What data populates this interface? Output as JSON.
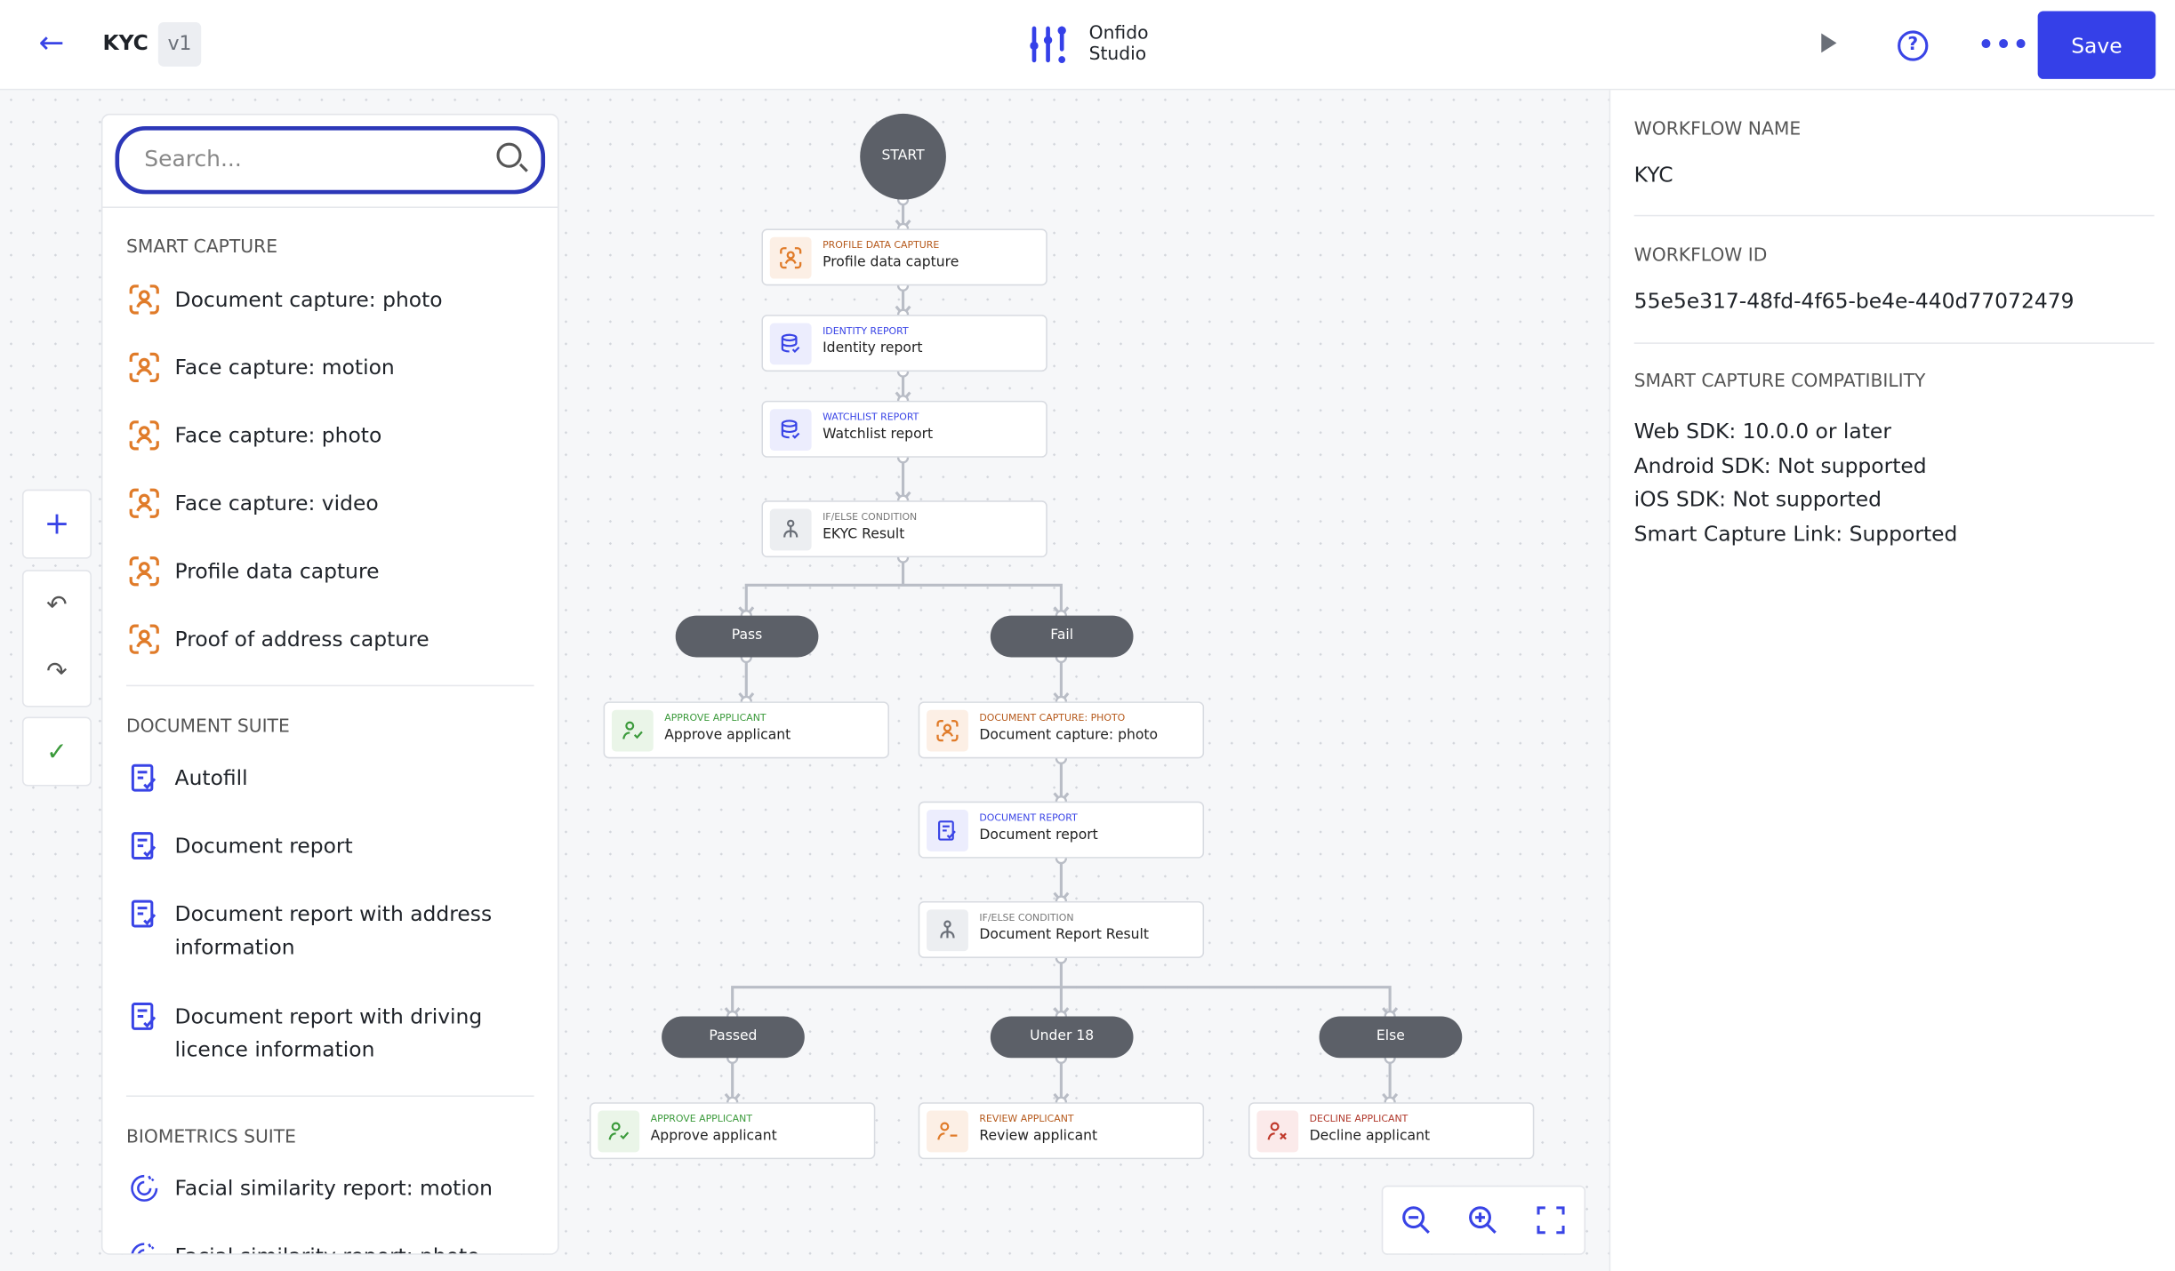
{
  "header": {
    "title": "KYC",
    "version": "v1",
    "brand_line1": "Onfido",
    "brand_line2": "Studio",
    "save_label": "Save",
    "help": "?",
    "more": "•••"
  },
  "colors": {
    "accent": "#3540e8",
    "capture": "#e07b29",
    "report": "#3944e6",
    "approve": "#3b9a3b",
    "decline": "#c0392b",
    "neutral": "#5c6068"
  },
  "search": {
    "placeholder": "Search...",
    "value": ""
  },
  "sidebar": {
    "sections": [
      {
        "title": "SMART CAPTURE",
        "items": [
          "Document capture: photo",
          "Face capture: motion",
          "Face capture: photo",
          "Face capture: video",
          "Profile data capture",
          "Proof of address capture"
        ]
      },
      {
        "title": "DOCUMENT SUITE",
        "items": [
          "Autofill",
          "Document report",
          "Document report with address information",
          "Document report with driving licence information"
        ]
      },
      {
        "title": "BIOMETRICS SUITE",
        "items": [
          "Facial similarity report: motion",
          "Facial similarity report: photo"
        ]
      }
    ]
  },
  "right_panel": {
    "workflow_name_label": "WORKFLOW NAME",
    "workflow_name": "KYC",
    "workflow_id_label": "WORKFLOW ID",
    "workflow_id": "55e5e317-48fd-4f65-be4e-440d77072479",
    "compat_label": "SMART CAPTURE COMPATIBILITY",
    "compat": [
      "Web SDK: 10.0.0 or later",
      "Android SDK: Not supported",
      "iOS SDK: Not supported",
      "Smart Capture Link: Supported"
    ]
  },
  "flow": {
    "start": "START",
    "nodes": [
      {
        "type": "Profile data capture",
        "name": "Profile data capture",
        "kind": "capture"
      },
      {
        "type": "Identity report",
        "name": "Identity report",
        "kind": "report"
      },
      {
        "type": "Watchlist report",
        "name": "Watchlist report",
        "kind": "report"
      },
      {
        "type": "If/else condition",
        "name": "EKYC Result",
        "kind": "condition"
      },
      {
        "type": "Approve applicant",
        "name": "Approve applicant",
        "kind": "approve"
      },
      {
        "type": "Document capture: photo",
        "name": "Document capture: photo",
        "kind": "capture"
      },
      {
        "type": "Document report",
        "name": "Document report",
        "kind": "docreport"
      },
      {
        "type": "If/else condition",
        "name": "Document Report Result",
        "kind": "condition"
      },
      {
        "type": "Approve applicant",
        "name": "Approve applicant",
        "kind": "approve"
      },
      {
        "type": "Review applicant",
        "name": "Review applicant",
        "kind": "review"
      },
      {
        "type": "Decline applicant",
        "name": "Decline applicant",
        "kind": "decline"
      }
    ],
    "branches": [
      "Pass",
      "Fail",
      "Passed",
      "Under 18",
      "Else"
    ]
  }
}
